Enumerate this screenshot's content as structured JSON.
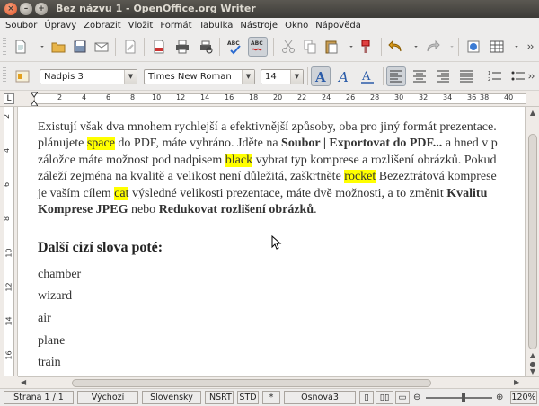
{
  "window": {
    "title": "Bez názvu 1 - OpenOffice.org Writer"
  },
  "menu": [
    "Soubor",
    "Úpravy",
    "Zobrazit",
    "Vložit",
    "Formát",
    "Tabulka",
    "Nástroje",
    "Okno",
    "Nápověda"
  ],
  "formatting": {
    "paragraph_style": "Nadpis 3",
    "font_name": "Times New Roman",
    "font_size": "14"
  },
  "toolbar_icons": {
    "spellcheck_label": "ABC",
    "autospell_label": "ABC"
  },
  "ruler": {
    "marks": [
      "2",
      "4",
      "6",
      "8",
      "10",
      "12",
      "14",
      "16",
      "18",
      "20",
      "22",
      "24",
      "26",
      "28",
      "30",
      "32",
      "34",
      "36",
      "38",
      "40"
    ]
  },
  "vruler": {
    "marks": [
      "2",
      "4",
      "6",
      "8",
      "10",
      "12",
      "14",
      "16"
    ]
  },
  "document": {
    "para1": {
      "l1": "Existují však dva mnohem rychlejší a efektivnější způsoby, oba pro jiný formát prezentace.",
      "l2_a": "plánujete ",
      "l2_hl": "space",
      "l2_b": " do PDF, máte vyhráno. Jděte na ",
      "l2_bold": "Soubor | Exportovat do PDF...",
      "l2_c": " a hned v p",
      "l3_a": "záložce máte možnost pod nadpisem ",
      "l3_hl": "black",
      "l3_b": " vybrat typ komprese a rozlišení obrázků. Pokud",
      "l4_a": "záleží zejména na kvalitě a velikost není důležitá, zaškrtněte ",
      "l4_hl": "rocket",
      "l4_b": " Bezeztrátová komprese",
      "l5_a": "je vaším cílem ",
      "l5_hl": "cat",
      "l5_b": " výsledné velikosti prezentace, máte dvě možnosti, a to změnit ",
      "l5_bold": "Kvalitu",
      "l6_bold1": "Komprese JPEG",
      "l6_a": " nebo ",
      "l6_bold2": "Redukovat rozlišení obrázků",
      "l6_b": "."
    },
    "heading": "Další cizí slova poté:",
    "words": [
      "chamber",
      "wizard",
      "air",
      "plane",
      "train"
    ]
  },
  "status": {
    "page": "Strana 1 / 1",
    "style": "Výchozí",
    "language": "Slovensky",
    "insert_mode": "INSRT",
    "selection_mode": "STD",
    "modified": "*",
    "outline": "Osnova3",
    "zoom": "120%"
  },
  "colors": {
    "highlight": "#ffff00",
    "titlebar": "#3c3b37"
  }
}
